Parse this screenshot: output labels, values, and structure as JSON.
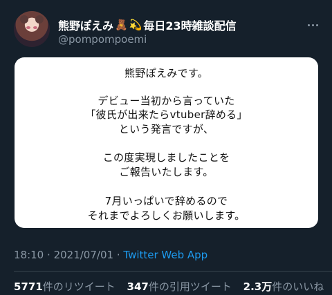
{
  "user": {
    "display_name": "熊野ぽえみ",
    "name_suffix": "毎日23時雑談配信",
    "handle": "@pompompoemi",
    "emoji1": "🧸",
    "emoji2": "💫"
  },
  "image_text": {
    "l1": "熊野ぽえみです。",
    "l2": "デビュー当初から言っていた",
    "l3": "「彼氏が出来たらvtuber辞める」",
    "l4": "という発言ですが、",
    "l5": "この度実現しましたことを",
    "l6": "ご報告いたします。",
    "l7": "7月いっぱいで辞めるので",
    "l8": "それまでよろしくお願いします。"
  },
  "meta": {
    "time": "18:10",
    "separator": "·",
    "date": "2021/07/01",
    "app": "Twitter Web App"
  },
  "stats": {
    "retweets_num": "5771",
    "retweets_label": "件のリツイート",
    "quotes_num": "347",
    "quotes_label": "件の引用ツイート",
    "likes_num": "2.3万",
    "likes_label": "件のいいね"
  },
  "colors": {
    "background": "#15202b",
    "secondary_text": "#8b98a5",
    "link": "#1d9bf0"
  }
}
